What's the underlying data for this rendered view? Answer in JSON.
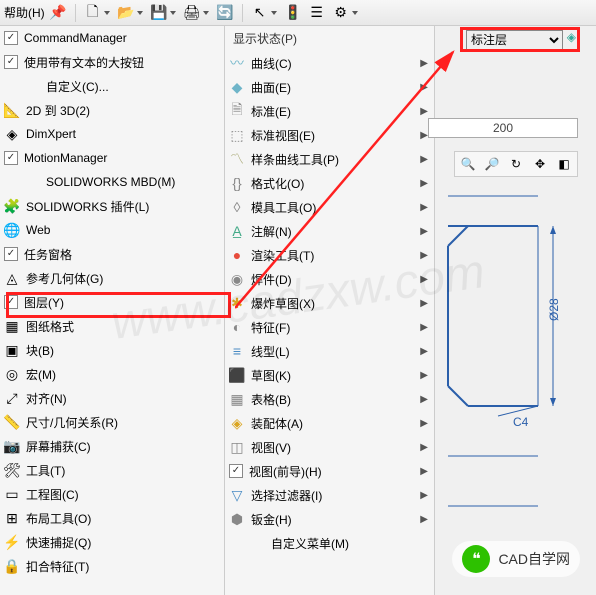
{
  "toolbar": {
    "help": "帮助(H)",
    "pin": "📌",
    "newdoc": "🗋",
    "open": "📂",
    "save": "💾",
    "print": "🖨",
    "conv": "🔄",
    "cursor": "↖",
    "traffic": "🚦",
    "menu": "☰",
    "gear": "⚙"
  },
  "layer_select": "标注层",
  "layer_icon": "◈",
  "left": [
    {
      "chk": true,
      "icon": "",
      "label": "CommandManager"
    },
    {
      "chk": true,
      "icon": "",
      "label": "使用带有文本的大按钮"
    },
    {
      "chk": false,
      "icon": "",
      "label": "自定义(C)...",
      "indent": true
    },
    {
      "chk": false,
      "icon": "📐",
      "label": "2D 到 3D(2)"
    },
    {
      "chk": false,
      "icon": "◈",
      "label": "DimXpert"
    },
    {
      "chk": true,
      "icon": "",
      "label": "MotionManager"
    },
    {
      "chk": false,
      "icon": "",
      "label": "SOLIDWORKS MBD(M)",
      "indent": true
    },
    {
      "chk": false,
      "icon": "🧩",
      "label": "SOLIDWORKS 插件(L)"
    },
    {
      "chk": false,
      "icon": "🌐",
      "label": "Web"
    },
    {
      "chk": true,
      "icon": "",
      "label": "任务窗格"
    },
    {
      "chk": false,
      "icon": "◬",
      "label": "参考几何体(G)"
    },
    {
      "chk": true,
      "icon": "",
      "label": "图层(Y)",
      "hl": true
    },
    {
      "chk": false,
      "icon": "▦",
      "label": "图纸格式"
    },
    {
      "chk": false,
      "icon": "▣",
      "label": "块(B)"
    },
    {
      "chk": false,
      "icon": "◎",
      "label": "宏(M)"
    },
    {
      "chk": false,
      "icon": "⤢",
      "label": "对齐(N)"
    },
    {
      "chk": false,
      "icon": "📏",
      "label": "尺寸/几何关系(R)"
    },
    {
      "chk": false,
      "icon": "📷",
      "label": "屏幕捕获(C)"
    },
    {
      "chk": false,
      "icon": "🛠",
      "label": "工具(T)"
    },
    {
      "chk": false,
      "icon": "▭",
      "label": "工程图(C)"
    },
    {
      "chk": false,
      "icon": "⊞",
      "label": "布局工具(O)"
    },
    {
      "chk": false,
      "icon": "⚡",
      "label": "快速捕捉(Q)"
    },
    {
      "chk": false,
      "icon": "🔒",
      "label": "扣合特征(T)"
    }
  ],
  "mid_header": "显示状态(P)",
  "mid": [
    {
      "icon": "〰",
      "c": "#6fb5c9",
      "label": "曲线(C)"
    },
    {
      "icon": "◆",
      "c": "#6fb5c9",
      "label": "曲面(E)"
    },
    {
      "icon": "🗎",
      "c": "#888",
      "label": "标准(E)"
    },
    {
      "icon": "⬚",
      "c": "#888",
      "label": "标准视图(E)"
    },
    {
      "icon": "〽",
      "c": "#aa7",
      "label": "样条曲线工具(P)"
    },
    {
      "icon": "{}",
      "c": "#888",
      "label": "格式化(O)"
    },
    {
      "icon": "◊",
      "c": "#888",
      "label": "模具工具(O)"
    },
    {
      "icon": "A̲",
      "c": "#4a8",
      "label": "注解(N)"
    },
    {
      "icon": "●",
      "c": "#e74c3c",
      "label": "渲染工具(T)"
    },
    {
      "icon": "◉",
      "c": "#888",
      "label": "焊件(D)"
    },
    {
      "icon": "✱",
      "c": "#daa520",
      "label": "爆炸草图(X)"
    },
    {
      "icon": "◐",
      "c": "#888",
      "label": "特征(F)"
    },
    {
      "icon": "≡",
      "c": "#4a8cc4",
      "label": "线型(L)"
    },
    {
      "icon": "⬛",
      "c": "#e67e22",
      "label": "草图(K)"
    },
    {
      "icon": "▦",
      "c": "#888",
      "label": "表格(B)"
    },
    {
      "icon": "◈",
      "c": "#daa520",
      "label": "装配体(A)"
    },
    {
      "icon": "◫",
      "c": "#888",
      "label": "视图(V)"
    },
    {
      "chk": true,
      "icon": "",
      "label": "视图(前导)(H)"
    },
    {
      "icon": "▽",
      "c": "#4a8cc4",
      "label": "选择过滤器(I)"
    },
    {
      "icon": "⬢",
      "c": "#888",
      "label": "钣金(H)"
    },
    {
      "icon": "",
      "label": "自定义菜单(M)",
      "indent": true
    }
  ],
  "ruler_text": "200",
  "dim1": "Ø28",
  "dim2": "C4",
  "wechat": "CAD自学网",
  "watermark": "www.cadzxw.com"
}
